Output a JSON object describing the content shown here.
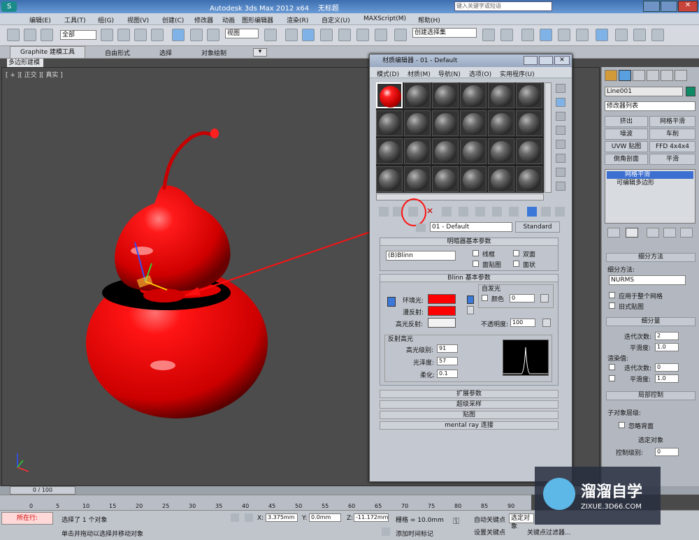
{
  "app": {
    "title": "Autodesk 3ds Max  2012 x64",
    "doc": "无标题",
    "search_placeholder": "键入关键字或短语"
  },
  "menu": [
    "编辑(E)",
    "工具(T)",
    "组(G)",
    "视图(V)",
    "创建(C)",
    "修改器",
    "动画",
    "图形编辑器",
    "渲染(R)",
    "自定义(U)",
    "MAXScript(M)",
    "帮助(H)"
  ],
  "toolbar": {
    "selection_filter": "全部",
    "view_dropdown": "视图",
    "named_selection": "创建选择集"
  },
  "ribbon": {
    "tabs": [
      "Graphite 建模工具",
      "自由形式",
      "选择",
      "对象绘制"
    ],
    "subtab": "多边形建模"
  },
  "viewport": {
    "label": "[ + ][ 正交 ][ 真实 ]"
  },
  "material_editor": {
    "title": "材质编辑器 - 01 - Default",
    "menus": [
      "模式(D)",
      "材质(M)",
      "导航(N)",
      "选项(O)",
      "实用程序(U)"
    ],
    "material_name": "01 - Default",
    "material_type": "Standard",
    "shader_rollout": "明暗器基本参数",
    "shader": "(B)Blinn",
    "shader_opts": [
      "线框",
      "双面",
      "面贴图",
      "面状"
    ],
    "blinn_rollout": "Blinn 基本参数",
    "self_illum": "自发光",
    "color_label": "颜色",
    "self_illum_val": "0",
    "ambient": "环境光:",
    "diffuse": "漫反射:",
    "specular": "高光反射:",
    "opacity_label": "不透明度:",
    "opacity": "100",
    "spec_group": "反射高光",
    "spec_level_label": "高光级别:",
    "spec_level": "91",
    "gloss_label": "光泽度:",
    "gloss": "57",
    "soften_label": "柔化:",
    "soften": "0.1",
    "rollouts": [
      "扩展参数",
      "超级采样",
      "贴图",
      "mental ray 连接"
    ],
    "diffuse_color": "#ff0000"
  },
  "command_panel": {
    "object_name": "Line001",
    "modifier_list": "修改器列表",
    "buttons": [
      "挤出",
      "网格平滑",
      "噪波",
      "车削",
      "UVW 贴图",
      "FFD 4x4x4",
      "倒角剖面",
      "平滑"
    ],
    "stack": [
      "网格平滑",
      "可编辑多边形"
    ],
    "subdiv_rollout": "细分方法",
    "subdiv_method_label": "细分方法:",
    "subdiv_method": "NURMS",
    "apply_whole": "应用于整个网格",
    "old_map": "旧式贴图",
    "subdiv_amount": "细分量",
    "iterations_label": "迭代次数:",
    "iterations": "2",
    "smoothness_label": "平滑度:",
    "smoothness": "1.0",
    "render_values": "渲染值:",
    "r_iterations": "0",
    "r_smoothness": "1.0",
    "local_control": "局部控制",
    "sub_level": "子对象层级:",
    "ignore_backface": "忽略背面",
    "selected_obj": "选定对象",
    "control_level": "控制级别:",
    "control_val": "0"
  },
  "timeline": {
    "frame": "0 / 100",
    "ticks": [
      "0",
      "5",
      "10",
      "15",
      "20",
      "25",
      "30",
      "35",
      "40",
      "45",
      "50",
      "55",
      "60",
      "65",
      "70",
      "75",
      "80",
      "85",
      "90"
    ]
  },
  "status": {
    "now": "所在行:",
    "selected": "选择了 1 个对象",
    "hint": "单击并拖动以选择并移动对象",
    "x": "3.375mm",
    "y": "0.0mm",
    "z": "-11.172mm",
    "grid": "栅格 = 10.0mm",
    "auto_key": "自动关键点",
    "selected_obj": "选定对象",
    "set_key": "设置关键点",
    "add_tag": "添加时间标记",
    "key_filter": "关键点过滤器..."
  },
  "watermark": {
    "name": "溜溜自学",
    "url": "ZIXUE.3D66.COM"
  }
}
